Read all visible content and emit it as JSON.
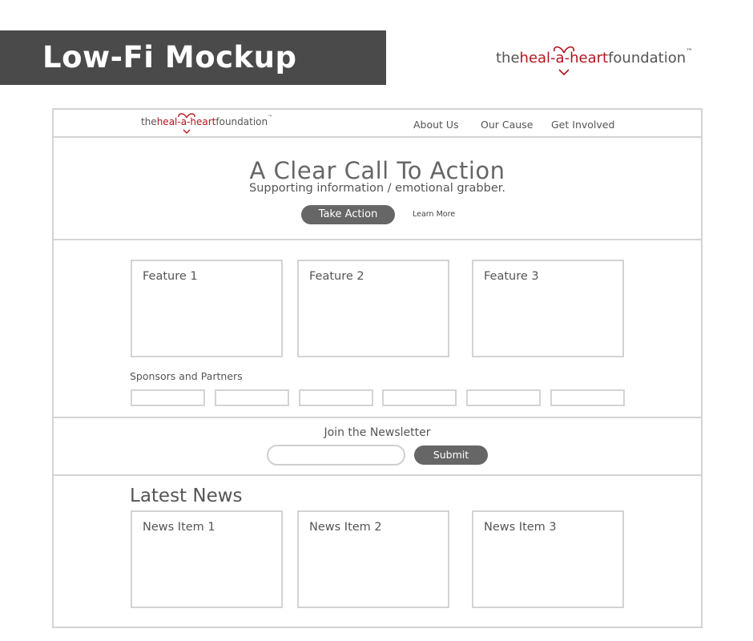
{
  "banner": {
    "title": "Low-Fi Mockup"
  },
  "logo": {
    "pre": "the",
    "mid": "heal-a-heart",
    "post": "foundation",
    "tm": "™"
  },
  "nav": {
    "items": [
      "About Us",
      "Our Cause",
      "Get Involved"
    ]
  },
  "hero": {
    "title": "A Clear Call To Action",
    "subtitle": "Supporting information / emotional grabber.",
    "primary_button": "Take Action",
    "secondary_link": "Learn More"
  },
  "features": {
    "items": [
      "Feature 1",
      "Feature 2",
      "Feature 3"
    ]
  },
  "sponsors": {
    "label": "Sponsors and Partners"
  },
  "newsletter": {
    "title": "Join the Newsletter",
    "submit_label": "Submit"
  },
  "news": {
    "title": "Latest News",
    "items": [
      "News Item 1",
      "News Item 2",
      "News Item 3"
    ]
  },
  "colors": {
    "brand_red": "#b3141d",
    "banner_bg": "#4a4a4a",
    "button_bg": "#666666",
    "border": "#d3d3d3"
  }
}
